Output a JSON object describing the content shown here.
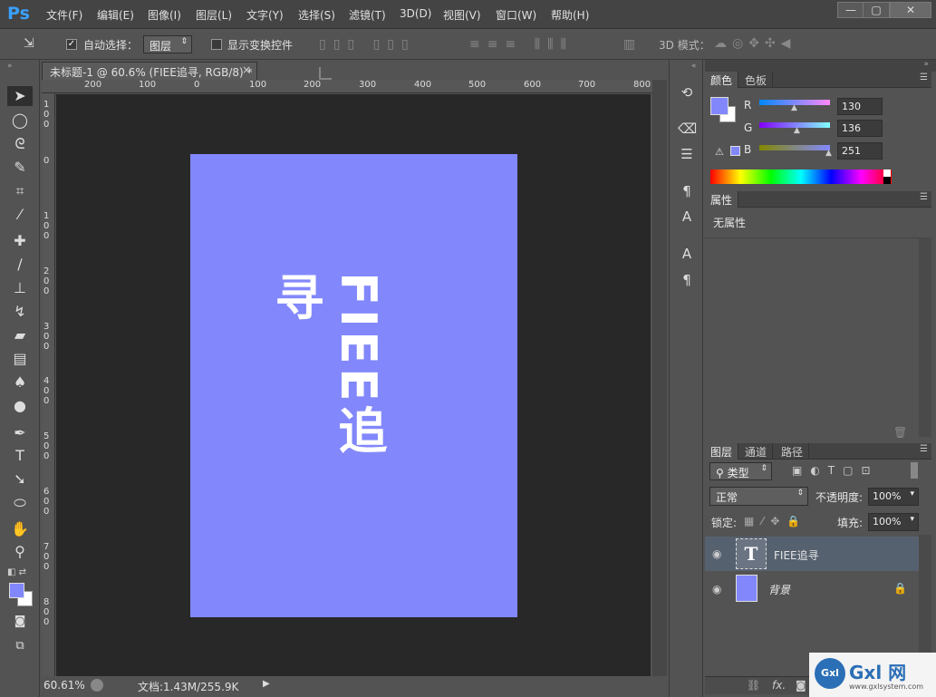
{
  "app": {
    "logo": "Ps"
  },
  "menu": [
    "文件(F)",
    "编辑(E)",
    "图像(I)",
    "图层(L)",
    "文字(Y)",
    "选择(S)",
    "滤镜(T)",
    "3D(D)",
    "视图(V)",
    "窗口(W)",
    "帮助(H)"
  ],
  "window_controls": {
    "minimize": "—",
    "maximize": "▢",
    "close": "✕"
  },
  "options": {
    "auto_select_label": "自动选择：",
    "auto_select_value": "图层",
    "show_transform_label": "显示变换控件",
    "mode_3d_label": "3D 模式："
  },
  "document": {
    "tab_title": "未标题-1 @ 60.6% (FIEE追寻, RGB/8) *",
    "close_glyph": "×",
    "text": "FIEE追寻",
    "background_color": "#8288fb",
    "zoom": "60.61%",
    "doc_info": "文档:1.43M/255.9K",
    "ruler_top": [
      "200",
      "100",
      "0",
      "100",
      "200",
      "300",
      "400",
      "500",
      "600",
      "700",
      "800"
    ],
    "ruler_left": [
      "100",
      "0",
      "100",
      "200",
      "300",
      "400",
      "500",
      "600",
      "700",
      "800"
    ]
  },
  "color_panel": {
    "tabs": [
      "颜色",
      "色板"
    ],
    "r_label": "R",
    "g_label": "G",
    "b_label": "B",
    "r": "130",
    "g": "136",
    "b": "251",
    "fg_color": "#8288fb"
  },
  "properties_panel": {
    "tab": "属性",
    "empty_text": "无属性"
  },
  "layers_panel": {
    "tabs": [
      "图层",
      "通道",
      "路径"
    ],
    "filter_label": "类型",
    "blend_mode": "正常",
    "opacity_label": "不透明度:",
    "opacity_value": "100%",
    "lock_label": "锁定:",
    "fill_label": "填充:",
    "fill_value": "100%",
    "layers": [
      {
        "name": "FIEE追寻",
        "type": "text",
        "thumb_glyph": "T"
      },
      {
        "name": "背景",
        "type": "background"
      }
    ],
    "footer_fx": "fx."
  },
  "watermark": {
    "text": "Gxl 网",
    "url": "www.gxlsystem.com"
  }
}
